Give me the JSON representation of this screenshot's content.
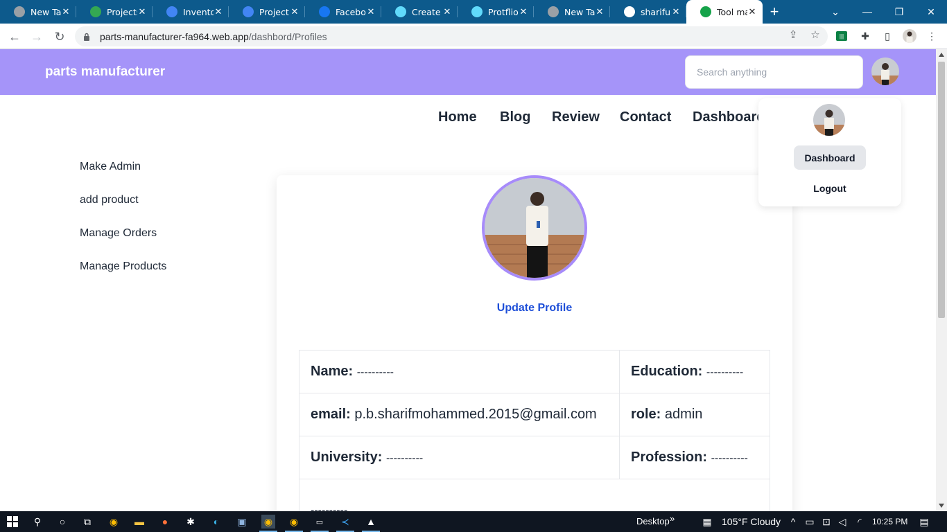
{
  "browser": {
    "tabs": [
      {
        "label": "New Tab",
        "icon": "chrome-icon",
        "color": "#9aa0a6"
      },
      {
        "label": "Projects",
        "icon": "google-drive-icon",
        "color": "#34a853"
      },
      {
        "label": "Inventor",
        "icon": "google-docs-icon",
        "color": "#4285f4"
      },
      {
        "label": "Project r",
        "icon": "google-docs-icon",
        "color": "#4285f4"
      },
      {
        "label": "Faceboo",
        "icon": "facebook-icon",
        "color": "#1877f2"
      },
      {
        "label": "Create a",
        "icon": "react-icon",
        "color": "#61dafb"
      },
      {
        "label": "Protflio",
        "icon": "react-icon",
        "color": "#61dafb"
      },
      {
        "label": "New Tab",
        "icon": "chrome-icon",
        "color": "#9aa0a6"
      },
      {
        "label": "shariful",
        "icon": "github-icon",
        "color": "#ffffff"
      },
      {
        "label": "Tool ma",
        "icon": "tool-icon",
        "color": "#16a34a",
        "active": true
      }
    ],
    "url_host": "parts-manufacturer-fa964.web.app",
    "url_path": "/dashbord/Profiles"
  },
  "header": {
    "brand": "parts manufacturer",
    "search_placeholder": "Search anything"
  },
  "nav": {
    "items": [
      "Home",
      "Blog",
      "Review",
      "Contact",
      "Dashboard"
    ]
  },
  "sidebar": {
    "items": [
      "Make Admin",
      "add product",
      "Manage Orders",
      "Manage Products"
    ]
  },
  "profile": {
    "update_label": "Update Profile",
    "fields": {
      "name_label": "Name:",
      "name_value": "----------",
      "education_label": "Education:",
      "education_value": "----------",
      "email_label": "email:",
      "email_value": "p.b.sharifmohammed.2015@gmail.com",
      "role_label": "role:",
      "role_value": "admin",
      "university_label": "University:",
      "university_value": "----------",
      "profession_label": "Profession:",
      "profession_value": "----------",
      "extra_value": "----------"
    }
  },
  "dropdown": {
    "dashboard_label": "Dashboard",
    "logout_label": "Logout"
  },
  "taskbar": {
    "desktop_label": "Desktop",
    "weather": "105°F  Cloudy",
    "time": "10:25 PM"
  },
  "colors": {
    "header_bg": "#a594f9",
    "accent": "#a78bfa",
    "link": "#1d4ed8"
  }
}
